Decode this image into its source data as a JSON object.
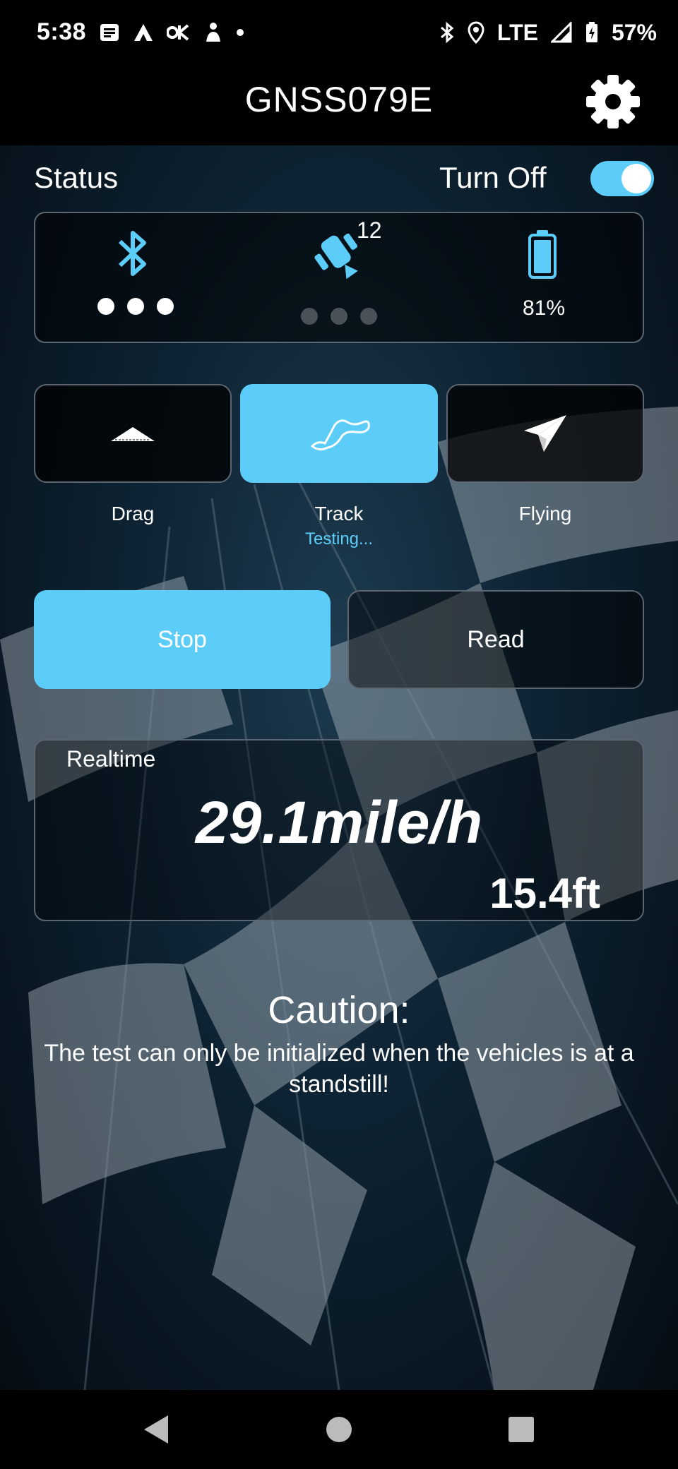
{
  "status_bar": {
    "time": "5:38",
    "network": "LTE",
    "battery": "57%"
  },
  "app_bar": {
    "title": "GNSS079E"
  },
  "status": {
    "label": "Status",
    "turn_off_label": "Turn Off",
    "toggle_on": true,
    "satellite_count": "12",
    "battery_percent": "81%"
  },
  "modes": [
    {
      "label": "Drag",
      "sub": ""
    },
    {
      "label": "Track",
      "sub": "Testing..."
    },
    {
      "label": "Flying",
      "sub": ""
    }
  ],
  "actions": {
    "stop_label": "Stop",
    "read_label": "Read"
  },
  "realtime": {
    "label": "Realtime",
    "speed": "29.1mile/h",
    "distance": "15.4ft"
  },
  "caution": {
    "title": "Caution:",
    "text": "The test can only be initialized when the vehicles is at a standstill!"
  },
  "colors": {
    "accent": "#5ccdf8",
    "border": "#5b6670"
  }
}
